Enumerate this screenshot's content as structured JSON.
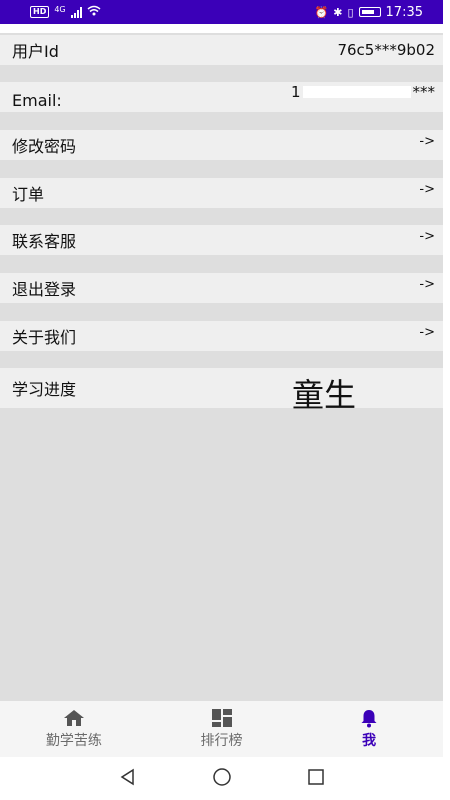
{
  "status_bar": {
    "hd": "HD",
    "network": "4G",
    "time": "17:35"
  },
  "profile": {
    "user_id": {
      "label": "用户Id",
      "value": "76c5***9b02"
    },
    "email": {
      "label": "Email:",
      "value_prefix": "1",
      "value_suffix": "***"
    },
    "change_password": {
      "label": "修改密码",
      "arrow": "->"
    },
    "orders": {
      "label": "订单",
      "arrow": "->"
    },
    "contact_support": {
      "label": "联系客服",
      "arrow": "->"
    },
    "logout": {
      "label": "退出登录",
      "arrow": "->"
    },
    "about_us": {
      "label": "关于我们",
      "arrow": "->"
    },
    "progress": {
      "label": "学习进度",
      "value": "童生"
    }
  },
  "bottom_nav": {
    "items": [
      {
        "label": "勤学苦练",
        "icon": "home-icon"
      },
      {
        "label": "排行榜",
        "icon": "dashboard-icon"
      },
      {
        "label": "我",
        "icon": "bell-icon",
        "active": true
      }
    ]
  },
  "colors": {
    "accent": "#3b00b8",
    "row_bg": "#efefef",
    "page_bg": "#dedede"
  }
}
